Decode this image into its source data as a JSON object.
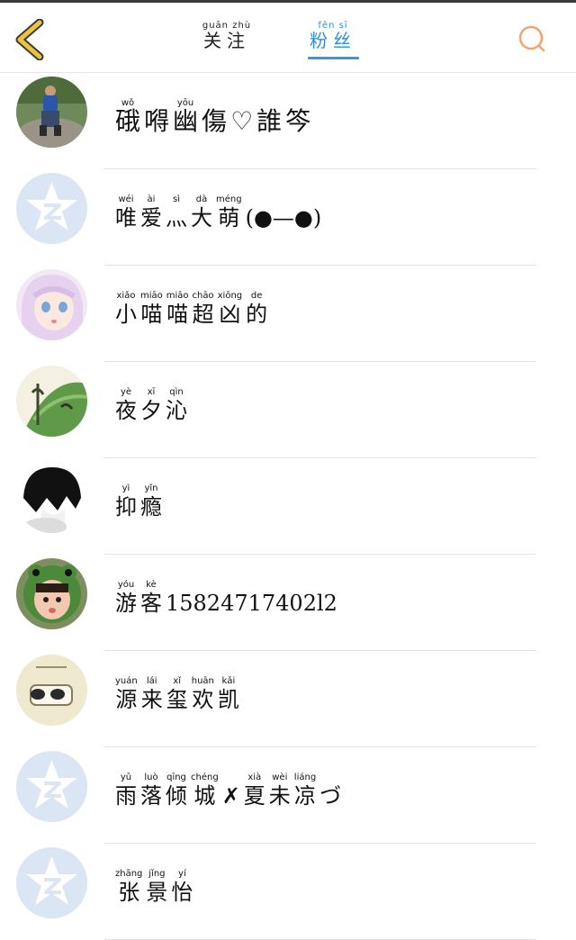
{
  "header": {
    "tabs": [
      {
        "id": "follow",
        "hanzi": [
          "关",
          "注"
        ],
        "pinyin": [
          "guān",
          "zhù"
        ]
      },
      {
        "id": "fans",
        "hanzi": [
          "粉",
          "丝"
        ],
        "pinyin": [
          "fěn",
          "sī"
        ],
        "active": true
      }
    ],
    "accent_color": "#3a98d6",
    "back_icon_color": "#f0c33c",
    "search_icon_color": "#f4a36a"
  },
  "fans": [
    {
      "avatar": "photo-man-rock",
      "plain": "",
      "chars": [
        {
          "h": "硪",
          "p": "wǒ"
        },
        {
          "h": "嘚",
          "p": ""
        },
        {
          "h": "幽",
          "p": "yōu"
        },
        {
          "h": "傷",
          "p": ""
        },
        {
          "h": "♡",
          "p": ""
        },
        {
          "h": "誰",
          "p": ""
        },
        {
          "h": "笒",
          "p": ""
        }
      ]
    },
    {
      "avatar": "default-star",
      "chars": [
        {
          "h": "唯",
          "p": "wéi"
        },
        {
          "h": "爱",
          "p": "ài"
        },
        {
          "h": "灬",
          "p": "sì"
        },
        {
          "h": "大",
          "p": "dà"
        },
        {
          "h": "萌",
          "p": "méng"
        },
        {
          "h": "(●—●)",
          "p": ""
        }
      ]
    },
    {
      "avatar": "anime-girl",
      "chars": [
        {
          "h": "小",
          "p": "xiǎo"
        },
        {
          "h": "喵",
          "p": "miāo"
        },
        {
          "h": "喵",
          "p": "miāo"
        },
        {
          "h": "超",
          "p": "chāo"
        },
        {
          "h": "凶",
          "p": "xiōng"
        },
        {
          "h": "的",
          "p": "de"
        }
      ]
    },
    {
      "avatar": "green-leaf",
      "chars": [
        {
          "h": "夜",
          "p": "yè"
        },
        {
          "h": "夕",
          "p": "xī"
        },
        {
          "h": "沁",
          "p": "qìn"
        }
      ]
    },
    {
      "avatar": "dark-hair-boy",
      "chars": [
        {
          "h": "抑",
          "p": "yì"
        },
        {
          "h": "瘾",
          "p": "yǐn"
        }
      ]
    },
    {
      "avatar": "baby-frog-hat",
      "chars": [
        {
          "h": "游",
          "p": "yóu"
        },
        {
          "h": "客",
          "p": "kè"
        },
        {
          "h": "15824717402l2",
          "p": ""
        }
      ]
    },
    {
      "avatar": "sketch-bag",
      "chars": [
        {
          "h": "源",
          "p": "yuán"
        },
        {
          "h": "来",
          "p": "lái"
        },
        {
          "h": "玺",
          "p": "xǐ"
        },
        {
          "h": "欢",
          "p": "huān"
        },
        {
          "h": "凯",
          "p": "kǎi"
        }
      ]
    },
    {
      "avatar": "default-star",
      "chars": [
        {
          "h": "雨",
          "p": "yǔ"
        },
        {
          "h": "落",
          "p": "luò"
        },
        {
          "h": "倾",
          "p": "qīng"
        },
        {
          "h": "城",
          "p": "chéng"
        },
        {
          "h": "✗",
          "p": ""
        },
        {
          "h": "夏",
          "p": "xià"
        },
        {
          "h": "未",
          "p": "wèi"
        },
        {
          "h": "凉",
          "p": "liáng"
        },
        {
          "h": "づ",
          "p": ""
        }
      ]
    },
    {
      "avatar": "default-star",
      "chars": [
        {
          "h": "张",
          "p": "zhāng"
        },
        {
          "h": "景",
          "p": "jǐng"
        },
        {
          "h": "怡",
          "p": "yí"
        }
      ]
    }
  ]
}
